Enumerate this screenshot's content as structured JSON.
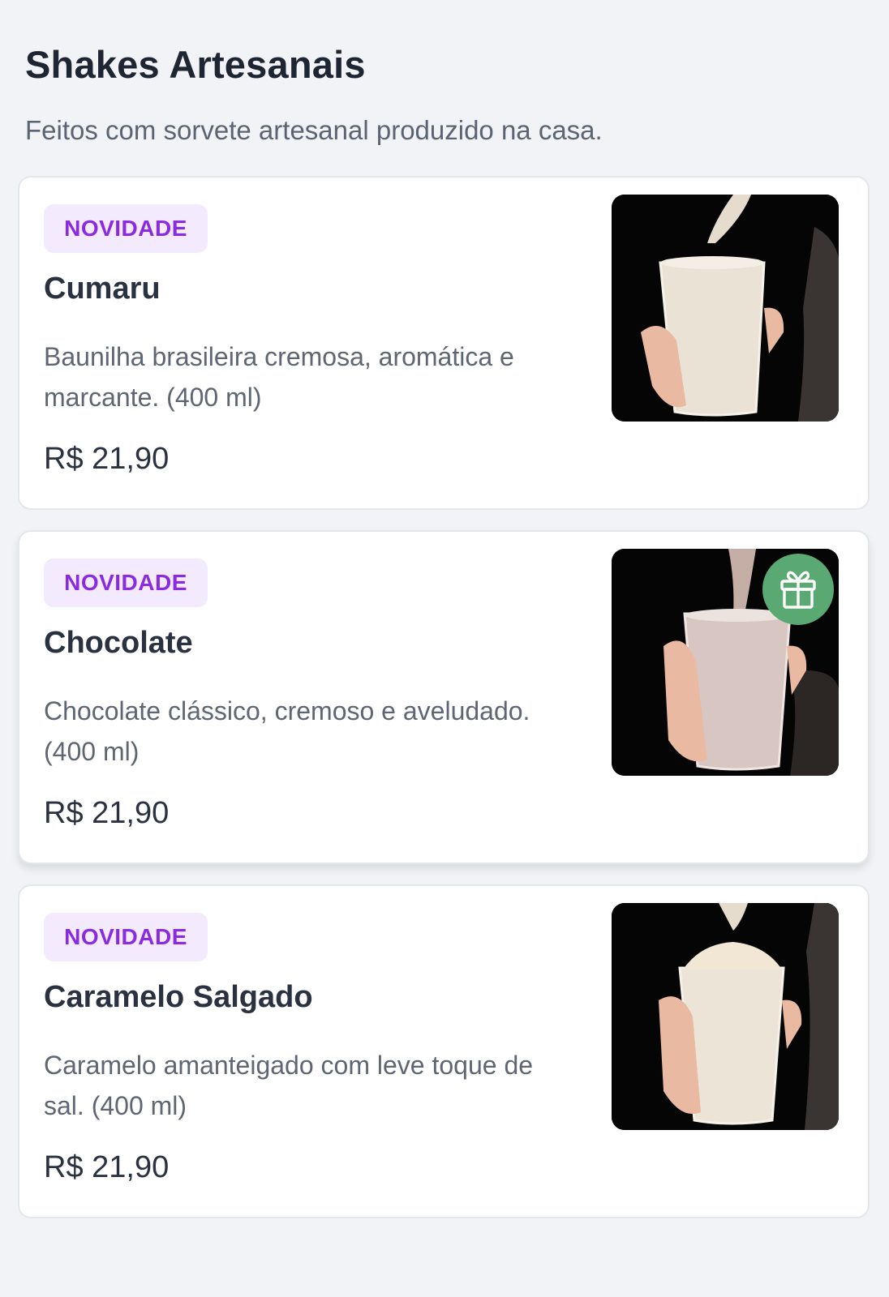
{
  "section": {
    "title": "Shakes Artesanais",
    "subtitle": "Feitos com sorvete artesanal produzido na casa."
  },
  "products": [
    {
      "badge": "NOVIDADE",
      "name": "Cumaru",
      "description": "Baunilha brasileira cremosa, aromática e marcante. (400 ml)",
      "price": "R$ 21,90",
      "image_icon": "cumaru-shake-photo",
      "shake_color": "#eae2d4",
      "has_gift": false
    },
    {
      "badge": "NOVIDADE",
      "name": "Chocolate",
      "description": "Chocolate clássico, cremoso e aveludado. (400 ml)",
      "price": "R$ 21,90",
      "image_icon": "chocolate-shake-photo",
      "shake_color": "#d8c6c2",
      "has_gift": true,
      "gift_icon": "gift-icon",
      "gift_color": "#5aa872"
    },
    {
      "badge": "NOVIDADE",
      "name": "Caramelo Salgado",
      "description": "Caramelo amanteigado com leve toque de sal. (400 ml)",
      "price": "R$ 21,90",
      "image_icon": "caramelo-shake-photo",
      "shake_color": "#ece4d6",
      "has_gift": false
    }
  ],
  "colors": {
    "background": "#f1f3f6",
    "badge_text": "#8a2be2",
    "badge_bg": "#f4eafd"
  }
}
